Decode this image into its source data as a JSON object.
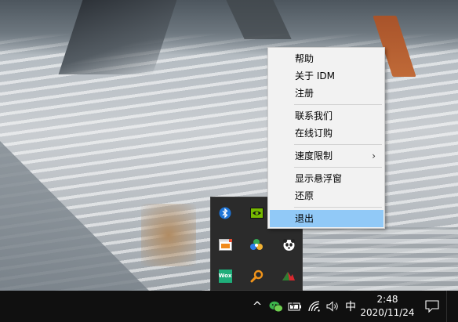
{
  "context_menu": {
    "items": [
      {
        "label": "帮助"
      },
      {
        "label": "关于 IDM"
      },
      {
        "label": "注册"
      },
      {
        "label": "联系我们"
      },
      {
        "label": "在线订购"
      },
      {
        "label": "速度限制",
        "submenu_arrow": "›"
      },
      {
        "label": "显示悬浮窗"
      },
      {
        "label": "还原"
      },
      {
        "label": "退出",
        "highlighted": true
      }
    ]
  },
  "tray_flyout": {
    "icons": [
      "bluetooth-icon",
      "nvidia-icon",
      "idm-icon",
      "network-mesh-icon",
      "panda-icon",
      "wox-icon",
      "search-magnifier-icon",
      "red-mountain-icon"
    ],
    "wox_label": "Wox"
  },
  "taskbar": {
    "overflow_chevron": "^",
    "ime_label": "中",
    "time": "2:48",
    "date": "2020/11/24",
    "icons": [
      "wechat-icon",
      "battery-icon",
      "wifi-icon",
      "volume-icon",
      "notification-icon"
    ]
  },
  "colors": {
    "menu_bg": "#f2f2f2",
    "menu_highlight": "#91c9f7",
    "taskbar_bg": "#101010",
    "flyout_bg": "#2b2b2b"
  }
}
